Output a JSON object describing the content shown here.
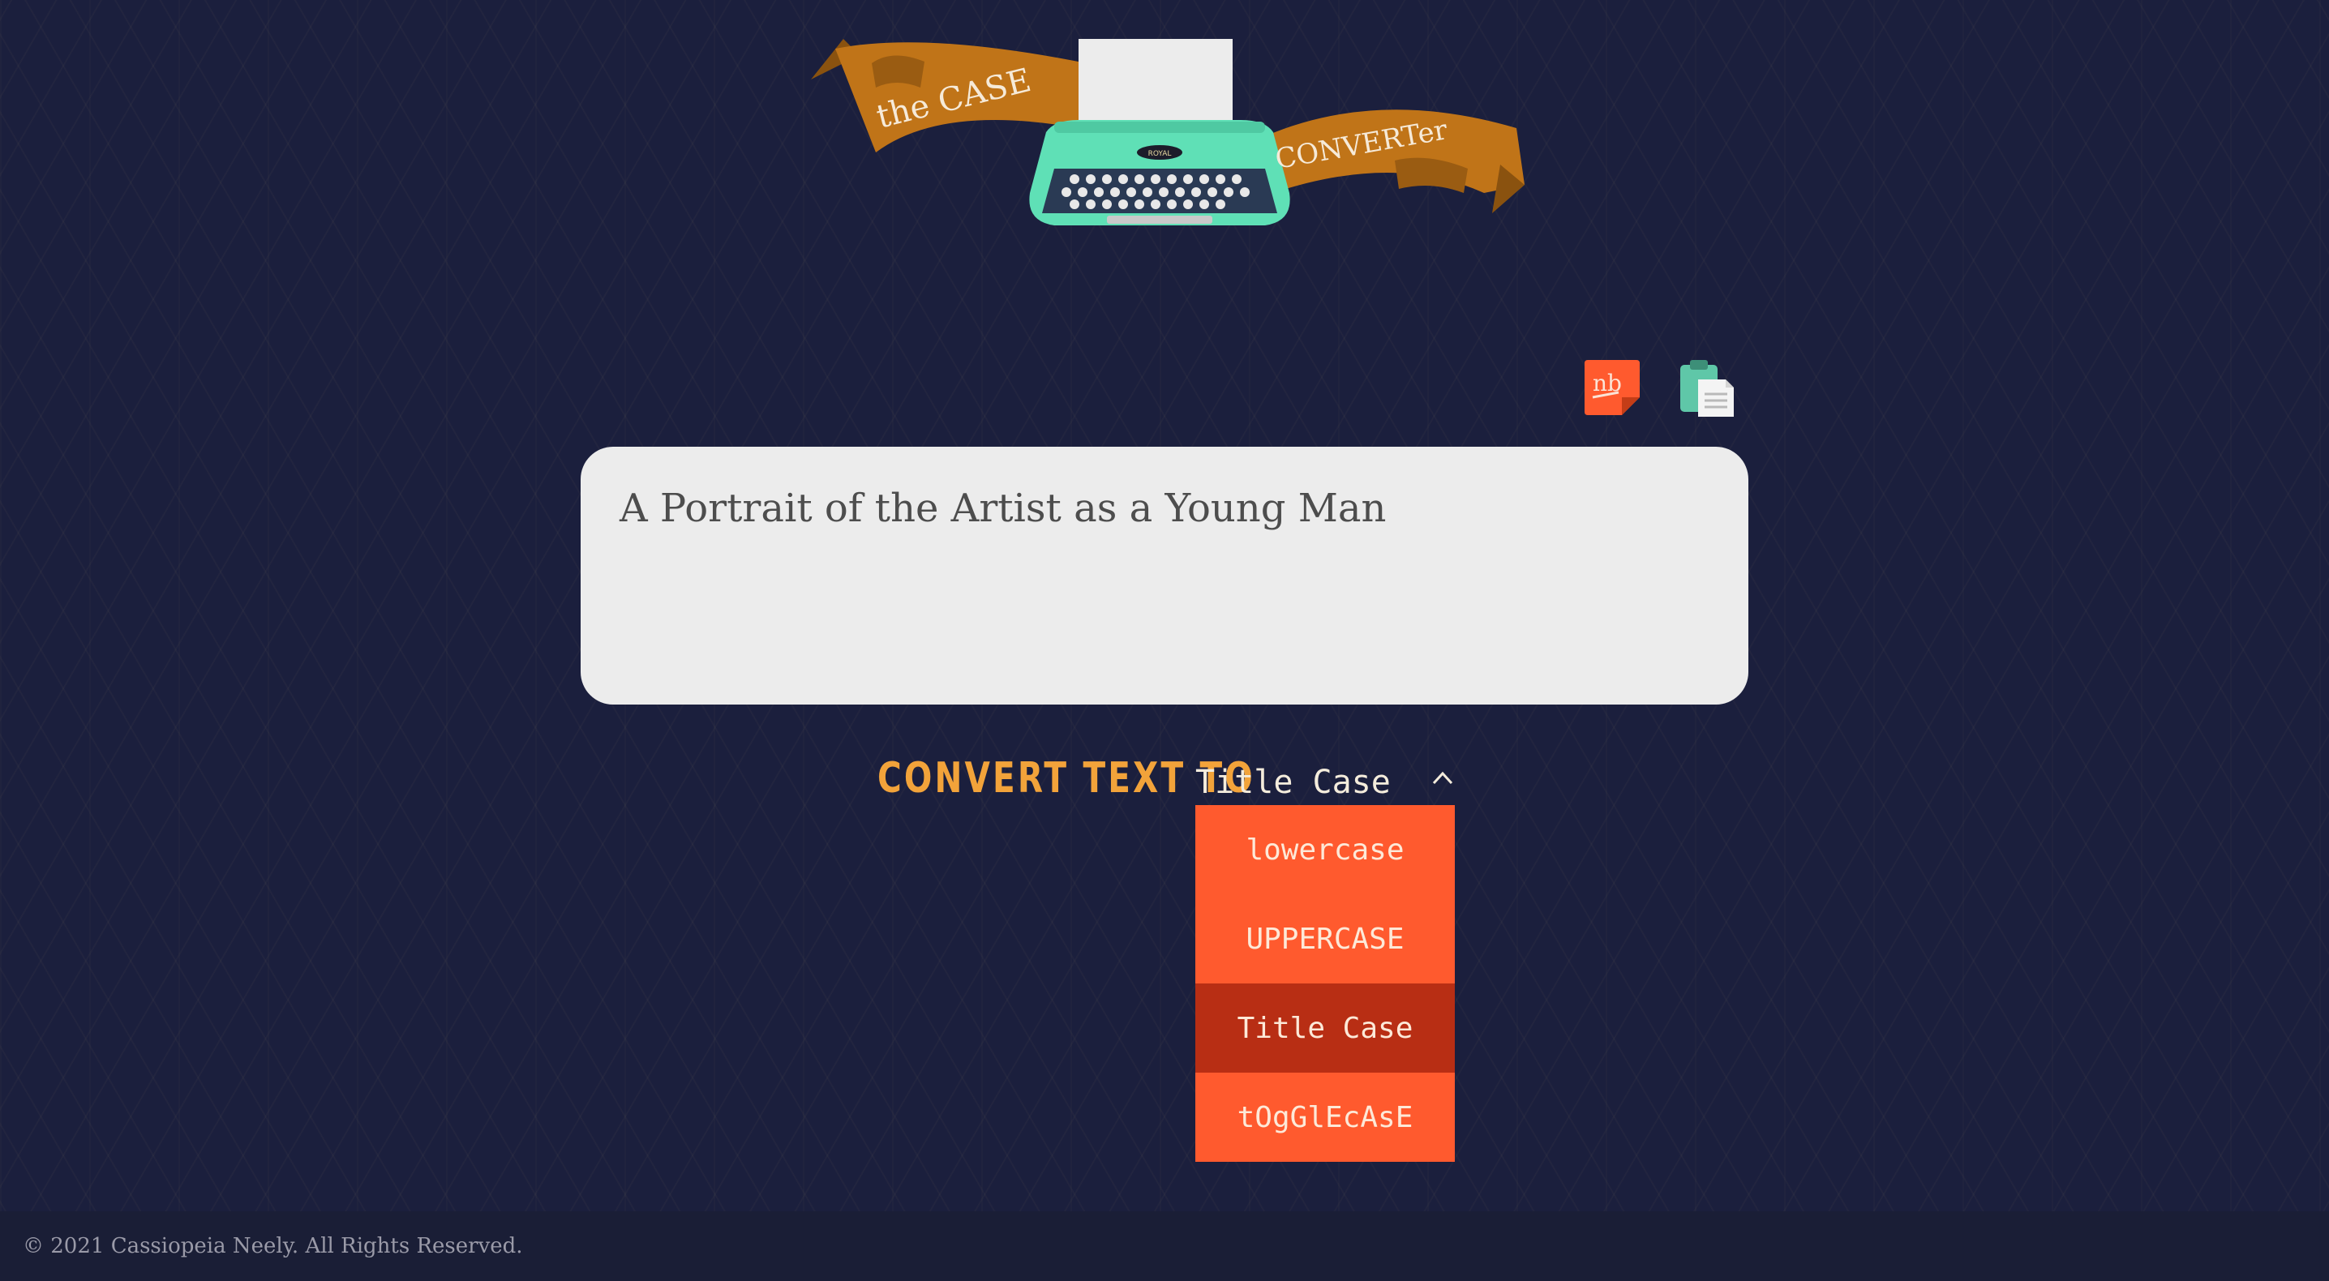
{
  "logo": {
    "banner_left": "the CASE",
    "banner_right": "CONVERTer",
    "typewriter_brand": "ROYAL"
  },
  "tools": {
    "notebook_icon": "notebook-icon",
    "notebook_label": "nb",
    "clipboard_icon": "clipboard-icon"
  },
  "editor": {
    "text": "A Portrait of the Artist as a Young Man"
  },
  "convert": {
    "label": "CONVERT TEXT TO",
    "selected": "Title Case",
    "options": [
      {
        "label": "lowercase"
      },
      {
        "label": "UPPERCASE"
      },
      {
        "label": "Title Case"
      },
      {
        "label": "tOgGlEcAsE"
      }
    ]
  },
  "footer": {
    "copyright": "© 2021 Cassiopeia Neely. All Rights Reserved."
  },
  "colors": {
    "background": "#1b1f3d",
    "banner": "#c07418",
    "typewriter": "#5fe0b6",
    "accent_orange": "#ff5a2e",
    "selected_option": "#b82e14",
    "label_gold": "#f2a33a"
  }
}
